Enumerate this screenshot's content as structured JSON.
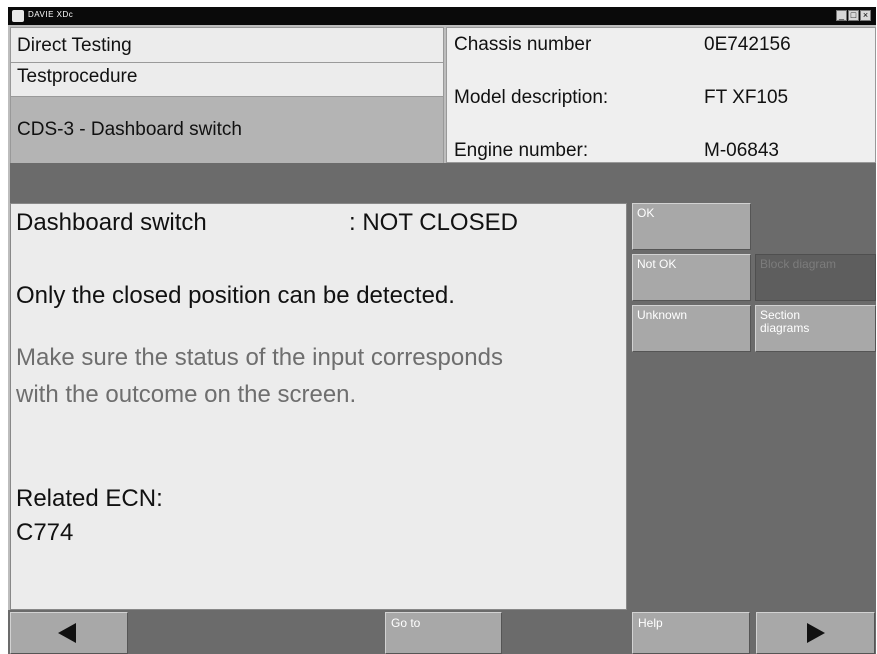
{
  "window": {
    "title": "DAVIE XDc"
  },
  "header": {
    "row1": "Direct Testing",
    "row2": "Testprocedure",
    "row3": "CDS-3 - Dashboard switch",
    "fields": [
      {
        "label": "Chassis number",
        "value": "0E742156"
      },
      {
        "label": "Model description:",
        "value": "FT XF105"
      },
      {
        "label": "Engine number:",
        "value": "M-06843"
      }
    ]
  },
  "content": {
    "status_label": "Dashboard switch",
    "status_value": ": NOT CLOSED",
    "line1": "Only the closed position can be detected.",
    "line2": "Make sure the status of the input corresponds",
    "line3": "with the outcome on the screen.",
    "ecn_label": "Related ECN:",
    "ecn_value": "C774"
  },
  "side_buttons": {
    "ok": "OK",
    "not_ok": "Not OK",
    "block_diagram": "Block diagram",
    "unknown": "Unknown",
    "section_diagrams_1": "Section",
    "section_diagrams_2": "diagrams"
  },
  "bottom": {
    "goto": "Go to",
    "help": "Help"
  }
}
